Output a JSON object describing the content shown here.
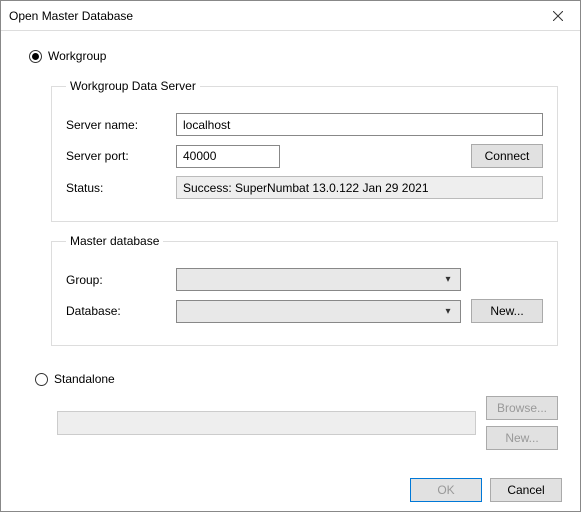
{
  "window": {
    "title": "Open Master Database"
  },
  "mode": {
    "workgroup_label": "Workgroup",
    "standalone_label": "Standalone",
    "selected": "workgroup"
  },
  "workgroup_server": {
    "legend": "Workgroup Data Server",
    "server_name_label": "Server name:",
    "server_name_value": "localhost",
    "server_port_label": "Server port:",
    "server_port_value": "40000",
    "connect_label": "Connect",
    "status_label": "Status:",
    "status_value": "Success: SuperNumbat 13.0.122 Jan 29 2021"
  },
  "master_db": {
    "legend": "Master database",
    "group_label": "Group:",
    "group_value": "",
    "database_label": "Database:",
    "database_value": "",
    "new_label": "New..."
  },
  "standalone": {
    "path_value": "",
    "browse_label": "Browse...",
    "new_label": "New..."
  },
  "footer": {
    "ok_label": "OK",
    "cancel_label": "Cancel"
  }
}
